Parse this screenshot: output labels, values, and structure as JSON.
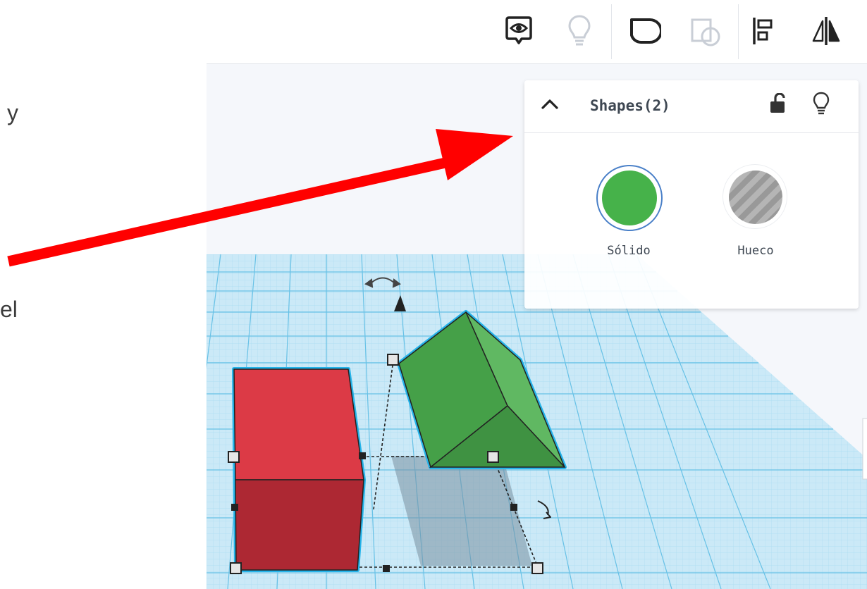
{
  "left_text": {
    "line1": "y",
    "line2": "el"
  },
  "toolbar": {
    "buttons": [
      {
        "icon": "show-notes-icon",
        "enabled": true
      },
      {
        "icon": "light-bulb-icon",
        "enabled": false
      },
      {
        "icon": "group-icon",
        "enabled": true
      },
      {
        "icon": "ungroup-icon",
        "enabled": false
      },
      {
        "icon": "align-icon",
        "enabled": true
      },
      {
        "icon": "mirror-icon",
        "enabled": true
      }
    ]
  },
  "inspector": {
    "title": "Shapes(2)",
    "collapse_icon": "chevron-up-icon",
    "lock_icon": "unlock-icon",
    "light_icon": "light-bulb-icon",
    "solid": {
      "label": "Sólido",
      "color": "#46b24a",
      "selected": true
    },
    "hole": {
      "label": "Hueco",
      "color": "#b5b5b5",
      "selected": false
    }
  },
  "scene": {
    "shapes": [
      {
        "name": "box",
        "color": "#dc3a46"
      },
      {
        "name": "roof-wedge",
        "color": "#45a048"
      }
    ],
    "selection_outline_color": "#25b4ea"
  },
  "annotation": {
    "arrow_color": "#ff0000"
  }
}
